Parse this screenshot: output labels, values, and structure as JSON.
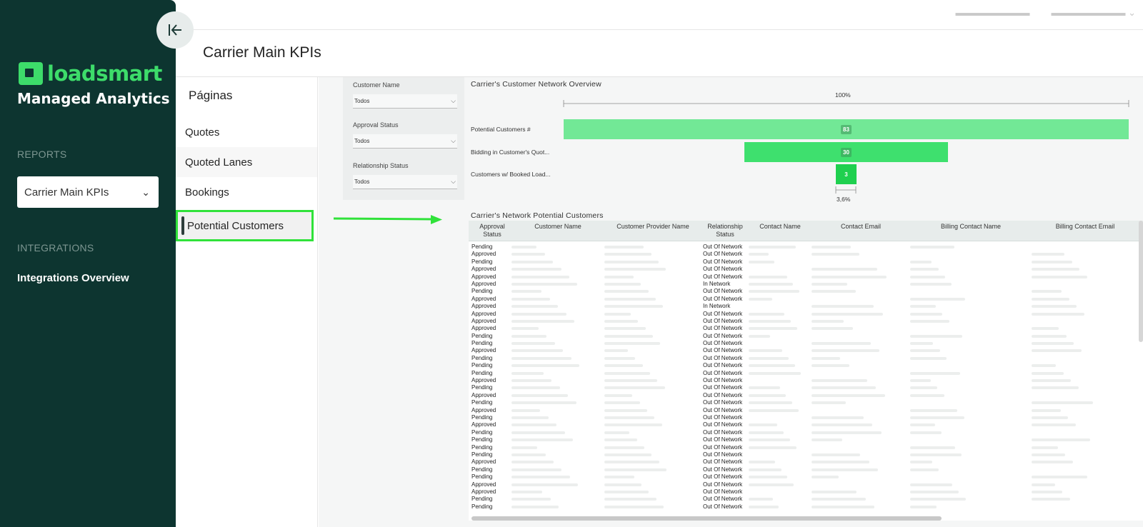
{
  "sidebar": {
    "brand": "loadsmart",
    "app_name": "Managed Analytics",
    "reports_label": "REPORTS",
    "report_selected": "Carrier Main KPIs",
    "integrations_label": "INTEGRATIONS",
    "integrations_link": "Integrations Overview"
  },
  "colors": {
    "sidebar_bg": "#0d3530",
    "brand_green": "#3ddc6a",
    "highlight": "#30e23a"
  },
  "header": {
    "page_title": "Carrier Main KPIs"
  },
  "pages": {
    "heading": "Páginas",
    "items": [
      {
        "label": "Quotes"
      },
      {
        "label": "Quoted Lanes"
      },
      {
        "label": "Bookings"
      },
      {
        "label": "Potential Customers"
      }
    ]
  },
  "filters": [
    {
      "label": "Customer Name",
      "value": "Todos"
    },
    {
      "label": "Approval Status",
      "value": "Todos"
    },
    {
      "label": "Relationship Status",
      "value": "Todos"
    }
  ],
  "funnel": {
    "title": "Carrier's Customer Network Overview",
    "top_pct": "100%",
    "bottom_pct": "3,6%",
    "rows": [
      {
        "label": "Potential Customers #",
        "value": "83",
        "fraction": 1.0
      },
      {
        "label": "Bidding in Customer's Quot...",
        "value": "30",
        "fraction": 0.3614
      },
      {
        "label": "Customers w/ Booked Load...",
        "value": "3",
        "fraction": 0.0361
      }
    ]
  },
  "table": {
    "title": "Carrier's Network Potential Customers",
    "columns": [
      "Approval Status",
      "Customer Name",
      "Customer Provider Name",
      "Relationship Status",
      "Contact Name",
      "Contact Email",
      "Billing Contact Name",
      "Billing Contact Email"
    ],
    "rows": [
      [
        "Pending",
        "Out Of Network"
      ],
      [
        "Approved",
        "Out Of Network"
      ],
      [
        "Pending",
        "Out Of Network"
      ],
      [
        "Approved",
        "Out Of Network"
      ],
      [
        "Approved",
        "Out Of Network"
      ],
      [
        "Approved",
        "In Network"
      ],
      [
        "Pending",
        "Out Of Network"
      ],
      [
        "Approved",
        "Out Of Network"
      ],
      [
        "Approved",
        "In Network"
      ],
      [
        "Approved",
        "Out Of Network"
      ],
      [
        "Approved",
        "Out Of Network"
      ],
      [
        "Approved",
        "Out Of Network"
      ],
      [
        "Pending",
        "Out Of Network"
      ],
      [
        "Pending",
        "Out Of Network"
      ],
      [
        "Approved",
        "Out Of Network"
      ],
      [
        "Pending",
        "Out Of Network"
      ],
      [
        "Pending",
        "Out Of Network"
      ],
      [
        "Pending",
        "Out Of Network"
      ],
      [
        "Approved",
        "Out Of Network"
      ],
      [
        "Pending",
        "Out Of Network"
      ],
      [
        "Approved",
        "Out Of Network"
      ],
      [
        "Pending",
        "Out Of Network"
      ],
      [
        "Approved",
        "Out Of Network"
      ],
      [
        "Pending",
        "Out Of Network"
      ],
      [
        "Approved",
        "Out Of Network"
      ],
      [
        "Pending",
        "Out Of Network"
      ],
      [
        "Pending",
        "Out Of Network"
      ],
      [
        "Pending",
        "Out Of Network"
      ],
      [
        "Pending",
        "Out Of Network"
      ],
      [
        "Approved",
        "Out Of Network"
      ],
      [
        "Pending",
        "Out Of Network"
      ],
      [
        "Pending",
        "Out Of Network"
      ],
      [
        "Approved",
        "Out Of Network"
      ],
      [
        "Approved",
        "Out Of Network"
      ],
      [
        "Pending",
        "Out Of Network"
      ],
      [
        "Pending",
        "Out Of Network"
      ]
    ]
  }
}
